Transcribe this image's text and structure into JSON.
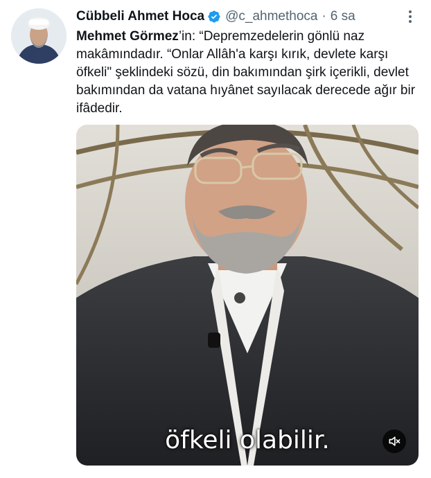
{
  "tweet": {
    "display_name": "Cübbeli Ahmet Hoca",
    "handle": "@c_ahmethoca",
    "separator": "·",
    "time": "6 sa",
    "verified": true,
    "mention_name": "Mehmet Görmez",
    "body_text": "’in: “Depremzedelerin gönlü naz makâmındadır. “Onlar Allâh'a karşı kırık, devlete karşı öfkeli\" şeklindeki sözü, din bakımından şirk içerikli, devlet bakımından da vatana hıyânet sayılacak derecede ağır bir ifâdedir."
  },
  "media": {
    "caption": "öfkeli olabilir.",
    "mute_icon": "speaker-muted-icon"
  },
  "icons": {
    "verified": "verified-badge-icon",
    "more": "more-options-icon"
  },
  "colors": {
    "primary_text": "#0f1419",
    "secondary_text": "#536471",
    "verified_blue": "#1d9bf0"
  }
}
